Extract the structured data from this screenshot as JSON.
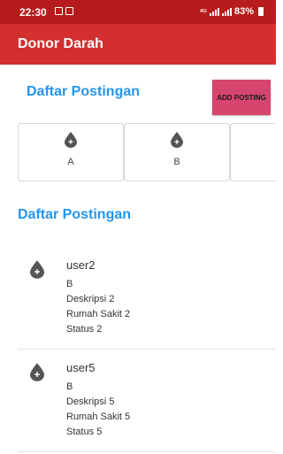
{
  "status_bar": {
    "time": "22:30",
    "network_label": "4G",
    "battery": "83%"
  },
  "app_bar": {
    "title": "Donor Darah"
  },
  "posts_section_top": {
    "title": "Daftar Postingan",
    "add_button_label": "ADD POSTING"
  },
  "blood_types": [
    {
      "label": "A"
    },
    {
      "label": "B"
    }
  ],
  "posts_section": {
    "title": "Daftar Postingan",
    "items": [
      {
        "user": "user2",
        "blood_type": "B",
        "description": "Deskripsi 2",
        "hospital": "Rumah Sakit 2",
        "status": "Status 2"
      },
      {
        "user": "user5",
        "blood_type": "B",
        "description": "Deskripsi 5",
        "hospital": "Rumah Sakit 5",
        "status": "Status 5"
      }
    ]
  },
  "colors": {
    "status_bar": "#b71c1c",
    "app_bar": "#d32f2f",
    "section_title": "#2196f3",
    "add_button": "#d6456e",
    "icon": "#555555"
  },
  "icons": {
    "blood_drop": "blood-drop-plus-icon"
  }
}
